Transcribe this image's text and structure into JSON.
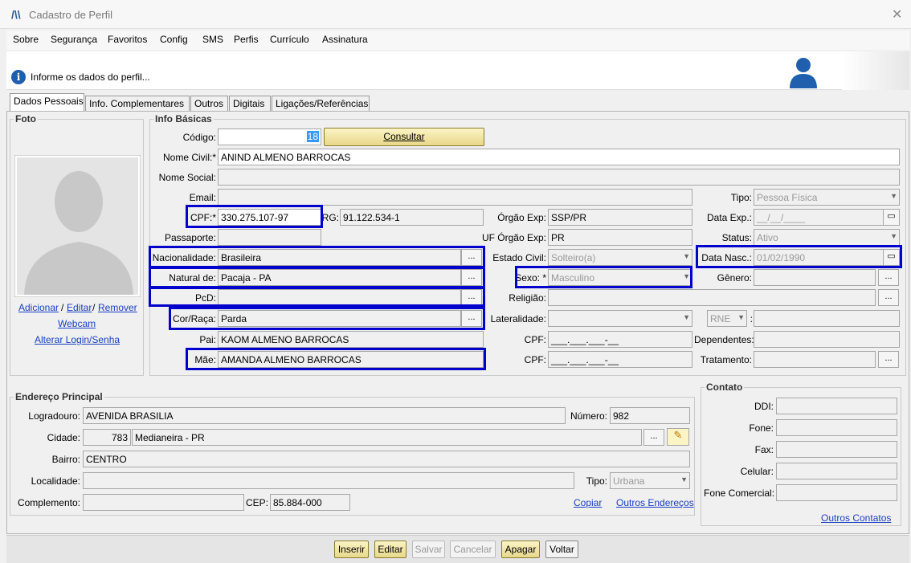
{
  "window": {
    "title": "Cadastro de Perfil",
    "close": "✕"
  },
  "menu": [
    "Sobre",
    "Segurança",
    "Favoritos",
    "Config",
    "SMS",
    "Perfis",
    "Currículo",
    "Assinatura"
  ],
  "info": {
    "text": "Informe os dados do perfil..."
  },
  "tabs": [
    "Dados Pessoais",
    "Info. Complementares",
    "Outros",
    "Digitais",
    "Ligações/Referências"
  ],
  "foto": {
    "title": "Foto",
    "links": {
      "adicionar": "Adicionar",
      "editar": "Editar",
      "remover": "Remover",
      "webcam": "Webcam",
      "alterar": "Alterar Login/Senha"
    }
  },
  "basicas": {
    "title": "Info Básicas",
    "codigo_label": "Código:",
    "codigo_value": "18",
    "consultar": "Consultar",
    "nome_civil_label": "Nome Civil:*",
    "nome_civil": "ANIND ALMENO BARROCAS",
    "nome_social_label": "Nome Social:",
    "nome_social": "",
    "email_label": "Email:",
    "email": "",
    "cpf_label": "CPF:*",
    "cpf": "330.275.107-97",
    "rg_label": "RG:",
    "rg": "91.122.534-1",
    "passaporte_label": "Passaporte:",
    "passaporte": "",
    "nacionalidade_label": "Nacionalidade:",
    "nacionalidade": "Brasileira",
    "natural_label": "Natural de:",
    "natural": "Pacaja - PA",
    "pcd_label": "PcD:",
    "pcd": "",
    "cor_label": "Cor/Raça:",
    "cor": "Parda",
    "pai_label": "Pai:",
    "pai": "KAOM ALMENO BARROCAS",
    "mae_label": "Mãe:",
    "mae": "AMANDA ALMENO BARROCAS",
    "orgao_label": "Órgão Exp:",
    "orgao": "SSP/PR",
    "uf_label": "UF Órgão Exp:",
    "uf": "PR",
    "estado_civil_label": "Estado Civil:",
    "estado_civil": "Solteiro(a)",
    "sexo_label": "Sexo: *",
    "sexo": "Masculino",
    "religiao_label": "Religião:",
    "religiao": "",
    "lateralidade_label": "Lateralidade:",
    "lateralidade": "",
    "cpf_pai_label": "CPF:",
    "cpf_pai": "___.___.___-__",
    "cpf_mae_label": "CPF:",
    "cpf_mae": "___.___.___-__",
    "tipo_label": "Tipo:",
    "tipo": "Pessoa Física",
    "data_exp_label": "Data Exp.:",
    "data_exp": "__/__/____",
    "status_label": "Status:",
    "status": "Ativo",
    "data_nasc_label": "Data Nasc.:",
    "data_nasc": "01/02/1990",
    "genero_label": "Gênero:",
    "genero": "",
    "rne": "RNE",
    "rne_sep": ":",
    "dependentes_label": "Dependentes:",
    "dependentes": "",
    "tratamento_label": "Tratamento:",
    "tratamento": ""
  },
  "endereco": {
    "title": "Endereço Principal",
    "logradouro_label": "Logradouro:",
    "logradouro": "AVENIDA BRASILIA",
    "numero_label": "Número:",
    "numero": "982",
    "cidade_label": "Cidade:",
    "cidade_code": "783",
    "cidade": "Medianeira - PR",
    "bairro_label": "Bairro:",
    "bairro": "CENTRO",
    "localidade_label": "Localidade:",
    "localidade": "",
    "tipo_label": "Tipo:",
    "tipo": "Urbana",
    "complemento_label": "Complemento:",
    "complemento": "",
    "cep_label": "CEP:",
    "cep": "85.884-000",
    "copiar": "Copiar",
    "outros": "Outros Endereços"
  },
  "contato": {
    "title": "Contato",
    "ddi_label": "DDI:",
    "fone_label": "Fone:",
    "fax_label": "Fax:",
    "celular_label": "Celular:",
    "fone_com_label": "Fone Comercial:",
    "outros": "Outros Contatos"
  },
  "buttons": {
    "inserir": "Inserir",
    "editar": "Editar",
    "salvar": "Salvar",
    "cancelar": "Cancelar",
    "apagar": "Apagar",
    "voltar": "Voltar"
  },
  "colors": {
    "highlight": "#0000cc",
    "link": "#1a3ec2",
    "brand": "#1f5fae"
  }
}
